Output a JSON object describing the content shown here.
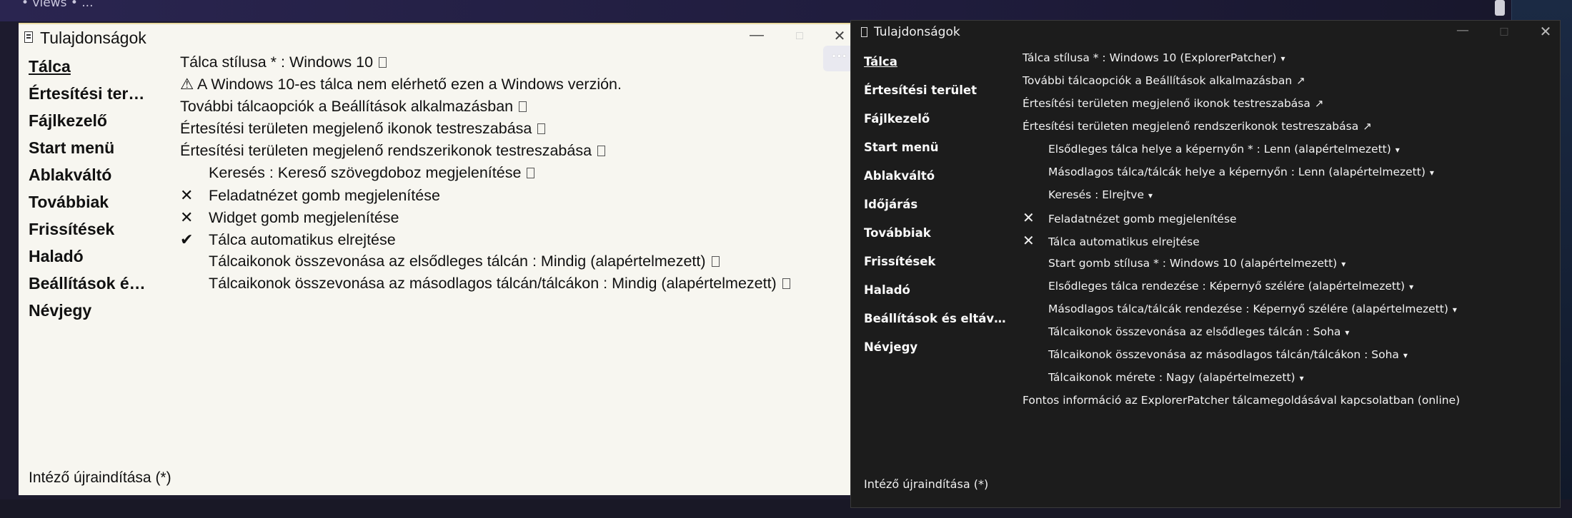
{
  "background": {
    "top_text": "• views • ..."
  },
  "left_window": {
    "title": "Tulajdonságok",
    "controls": {
      "minimize": "—",
      "maximize": "□",
      "close": "✕",
      "more": "···"
    },
    "nav": [
      "Tálca",
      "Értesítési ter…",
      "Fájlkezelő",
      "Start menü",
      "Ablakváltó",
      "Továbbiak",
      "Frissítések",
      "Haladó",
      "Beállítások é…",
      "Névjegy"
    ],
    "rows": [
      {
        "text": "Tálca stílusa * : Windows 10"
      },
      {
        "text": "⚠ A Windows 10-es tálca nem elérhető ezen a Windows verzión."
      },
      {
        "text": "További tálcaopciók a Beállítások alkalmazásban"
      },
      {
        "text": "Értesítési területen megjelenő ikonok testreszabása"
      },
      {
        "text": "Értesítési területen megjelenő rendszerikonok testreszabása"
      },
      {
        "text": "Keresés : Kereső szövegdoboz megjelenítése"
      },
      {
        "text": "Feladatnézet gomb megjelenítése",
        "mark": "✕"
      },
      {
        "text": "Widget gomb megjelenítése",
        "mark": "✕"
      },
      {
        "text": "Tálca automatikus elrejtése",
        "mark": "✔"
      },
      {
        "text": "Tálcaikonok összevonása az elsődleges tálcán : Mindig (alapértelmezett)"
      },
      {
        "text": "Tálcaikonok összevonása az másodlagos tálcán/tálcákon : Mindig (alapértelmezett)"
      }
    ],
    "footer": "Intéző újraindítása (*)"
  },
  "right_window": {
    "title": "Tulajdonságok",
    "controls": {
      "minimize": "—",
      "maximize": "□",
      "close": "✕"
    },
    "nav": [
      "Tálca",
      "Értesítési terület",
      "Fájlkezelő",
      "Start menü",
      "Ablakváltó",
      "Időjárás",
      "Továbbiak",
      "Frissítések",
      "Haladó",
      "Beállítások és eltáv…",
      "Névjegy"
    ],
    "rows": [
      {
        "text": "Tálca stílusa * : Windows 10 (ExplorerPatcher)",
        "suffix": "▾"
      },
      {
        "text": "További tálcaopciók a Beállítások alkalmazásban",
        "suffix": "↗"
      },
      {
        "text": "Értesítési területen megjelenő ikonok testreszabása",
        "suffix": "↗"
      },
      {
        "text": "Értesítési területen megjelenő rendszerikonok testreszabása",
        "suffix": "↗"
      },
      {
        "text": "Elsődleges tálca helye a képernyőn * : Lenn (alapértelmezett)",
        "suffix": "▾"
      },
      {
        "text": "Másodlagos tálca/tálcák helye a képernyőn : Lenn (alapértelmezett)",
        "suffix": "▾"
      },
      {
        "text": "Keresés : Elrejtve",
        "suffix": "▾"
      },
      {
        "text": "Feladatnézet gomb megjelenítése",
        "mark": "✕"
      },
      {
        "text": "Tálca automatikus elrejtése",
        "mark": "✕"
      },
      {
        "text": "Start gomb stílusa * : Windows 10 (alapértelmezett)",
        "suffix": "▾"
      },
      {
        "text": "Elsődleges tálca rendezése : Képernyő szélére (alapértelmezett)",
        "suffix": "▾"
      },
      {
        "text": "Másodlagos tálca/tálcák rendezése : Képernyő szélére (alapértelmezett)",
        "suffix": "▾"
      },
      {
        "text": "Tálcaikonok összevonása az elsődleges tálcán : Soha",
        "suffix": "▾"
      },
      {
        "text": "Tálcaikonok összevonása az másodlagos tálcán/tálcákon : Soha",
        "suffix": "▾"
      },
      {
        "text": "Tálcaikonok mérete : Nagy (alapértelmezett)",
        "suffix": "▾"
      },
      {
        "text": "Fontos információ az ExplorerPatcher tálcamegoldásával kapcsolatban (online)"
      }
    ],
    "footer": "Intéző újraindítása (*)"
  }
}
